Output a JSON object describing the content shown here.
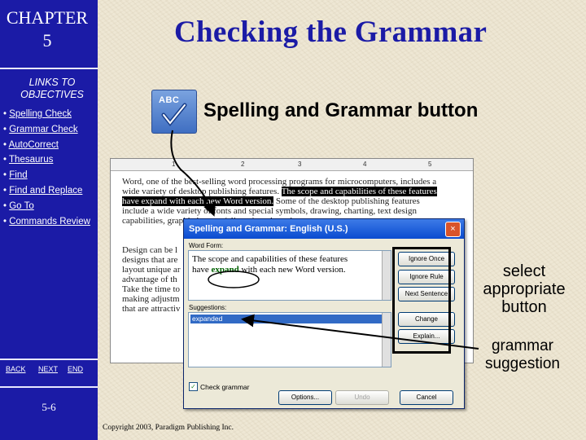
{
  "sidebar": {
    "chapter_line1": "CHAPTER",
    "chapter_line2": "5",
    "links_title_line1": "LINKS TO",
    "links_title_line2": "OBJECTIVES",
    "items": [
      {
        "label": "Spelling Check"
      },
      {
        "label": "Grammar Check"
      },
      {
        "label": "AutoCorrect"
      },
      {
        "label": "Thesaurus"
      },
      {
        "label": "Find"
      },
      {
        "label": "Find and Replace"
      },
      {
        "label": "Go To"
      },
      {
        "label": "Commands Review"
      }
    ],
    "bullet": "•",
    "back": "BACK",
    "next": "NEXT",
    "end": "END",
    "page_number": "5-6"
  },
  "slide": {
    "title": "Checking the Grammar",
    "button_icon_text": "ABC",
    "button_caption": "Spelling and Grammar button",
    "note_select_line1": "select",
    "note_select_line2": "appropriate",
    "note_select_line3": "button",
    "note_grammar_line1": "grammar",
    "note_grammar_line2": "suggestion",
    "copyright": "Copyright 2003, Paradigm Publishing Inc."
  },
  "document": {
    "ruler_ticks": [
      "1",
      "2",
      "3",
      "4",
      "5"
    ],
    "line1": "Word, one of the best-selling word processing programs for microcomputers, includes a",
    "line2_pre": "wide variety of desktop publishing features.",
    "line2_hl": "The scope and capabilities of these features",
    "line3_hl": "have expand with each new Word version.",
    "line3_post": "Some of the desktop publishing features",
    "line4": "include a wide variety of fonts and special symbols, drawing, charting, text design",
    "line5": "capabilities, graphic images (clip art), and much more.",
    "para2_1": "Design can be l",
    "para2_2": "designs that are",
    "para2_3": "layout unique ar",
    "para2_4": "advantage of th",
    "para2_5": "Take the time to",
    "para2_6": "making adjustm",
    "para2_7": "that are attractiv"
  },
  "dialog": {
    "title": "Spelling and Grammar: English (U.S.)",
    "close": "×",
    "word_form_label": "Word Form:",
    "text_line1": "The scope and capabilities of these features",
    "text_line2_pre": "have ",
    "text_line2_word": "expand",
    "text_line2_post": " with each new Word version.",
    "suggestions_label": "Suggestions:",
    "suggestion_selected": "expanded",
    "btn_ignore_once": "Ignore Once",
    "btn_ignore_rule": "Ignore Rule",
    "btn_next_sentence": "Next Sentence",
    "btn_change": "Change",
    "btn_explain": "Explain...",
    "check_grammar_label": "Check grammar",
    "btn_options": "Options...",
    "btn_undo": "Undo",
    "btn_cancel": "Cancel"
  },
  "colors": {
    "sidebar": "#1b1ba6",
    "title": "#1b1ba6",
    "dialog_titlebar": "#0a4bd0",
    "selection": "#316ac5"
  }
}
